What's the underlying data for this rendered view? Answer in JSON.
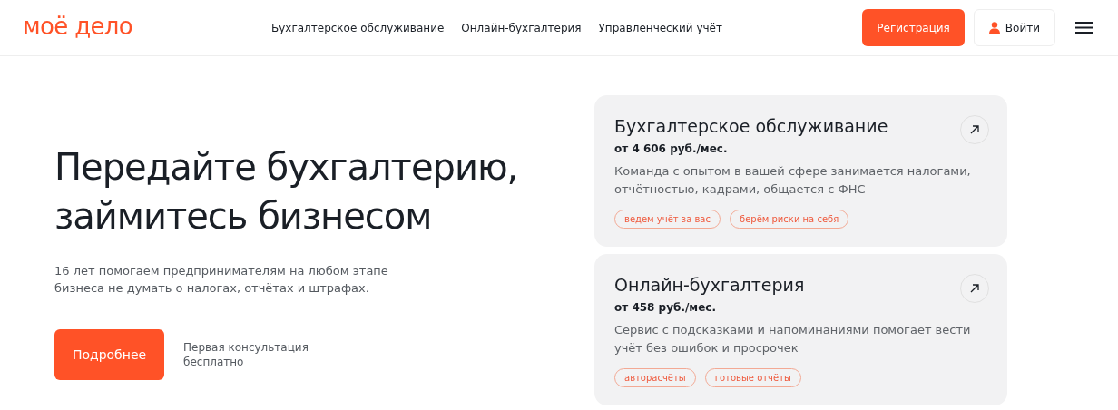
{
  "header": {
    "logo": "моё дело",
    "nav": [
      "Бухгалтерское обслуживание",
      "Онлайн-бухгалтерия",
      "Управленческий учёт"
    ],
    "register": "Регистрация",
    "login": "Войти"
  },
  "hero": {
    "title": "Передайте бухгалтерию, займитесь бизнесом",
    "subtitle": "16 лет помогаем предпринимателям на любом этапе бизнеса не думать о налогах, отчётах и штрафах.",
    "button": "Подробнее",
    "note": "Первая консультация бесплатно"
  },
  "cards": [
    {
      "title": "Бухгалтерское обслуживание",
      "price": "от 4 606 руб./мес.",
      "description": "Команда с опытом в вашей сфере занимается налогами, отчётностью, кадрами, общается с ФНС",
      "tags": [
        "ведем учёт за вас",
        "берём риски на себя"
      ]
    },
    {
      "title": "Онлайн-бухгалтерия",
      "price": "от 458 руб./мес.",
      "description": "Сервис с подсказками и напоминаниями помогает вести учёт без ошибок и просрочек",
      "tags": [
        "авторасчёты",
        "готовые отчёты"
      ]
    }
  ]
}
